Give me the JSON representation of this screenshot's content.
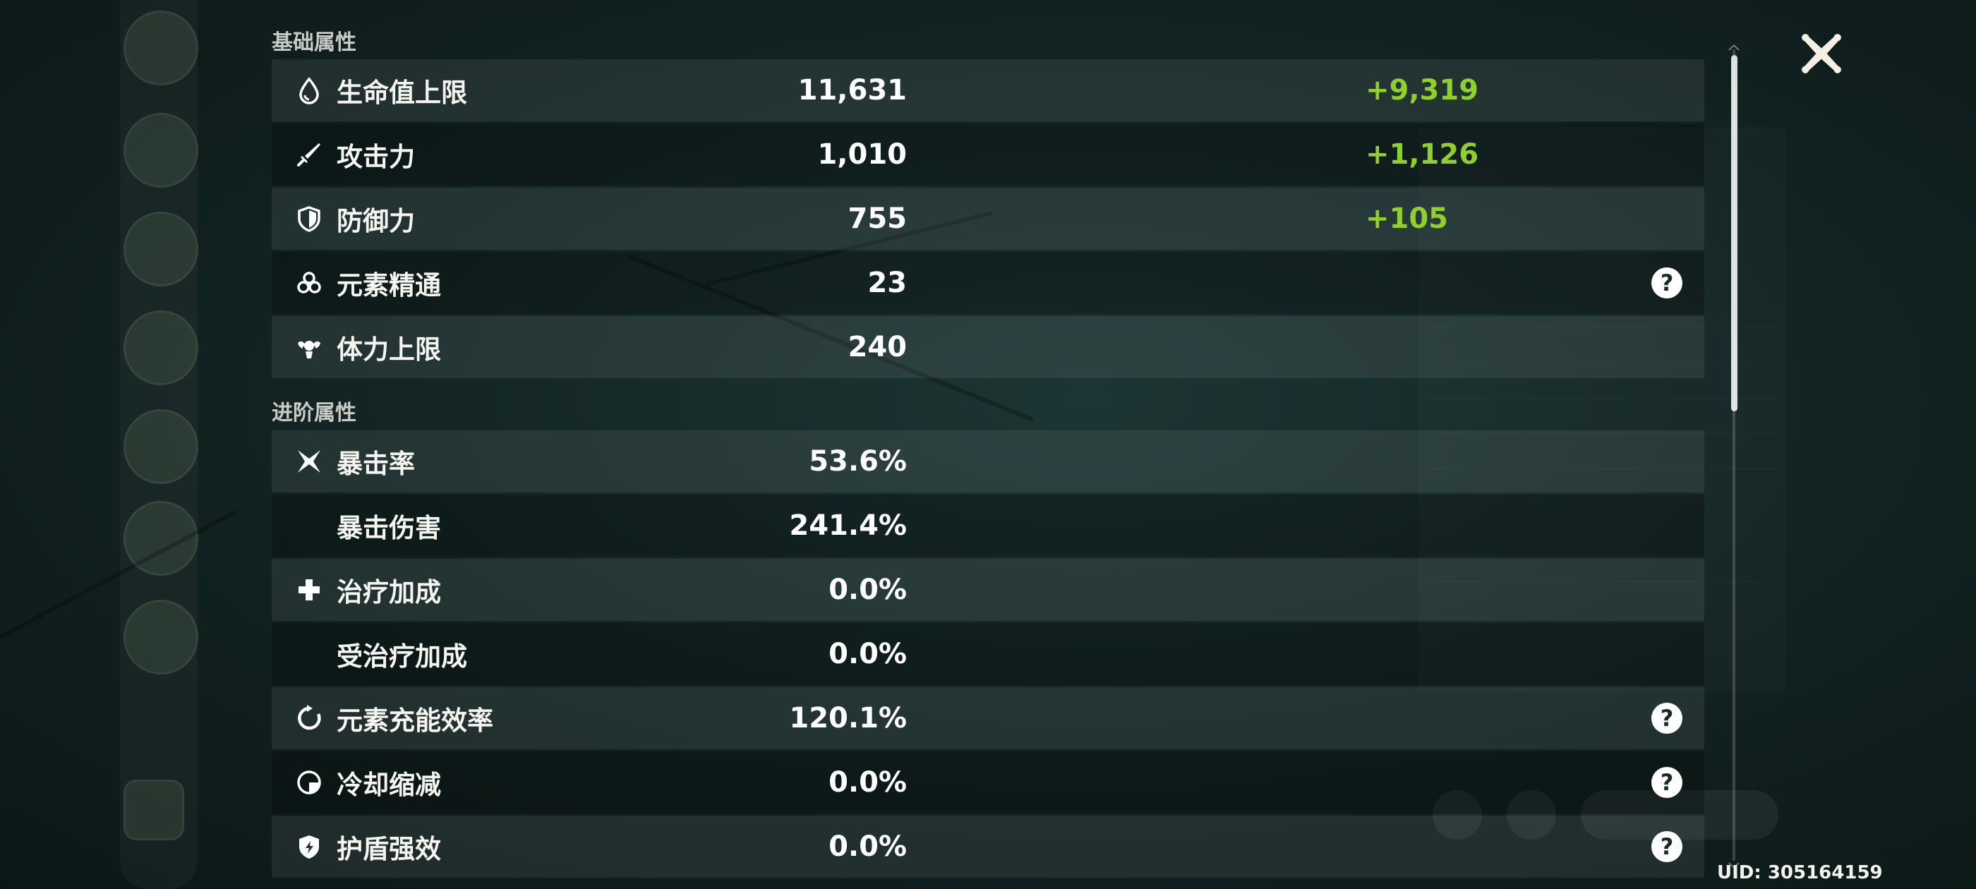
{
  "sections": {
    "basic_title": "基础属性",
    "advanced_title": "进阶属性"
  },
  "basic_stats": [
    {
      "label": "生命值上限",
      "value": "11,631",
      "bonus": "+9,319",
      "icon": "hp-drop-icon"
    },
    {
      "label": "攻击力",
      "value": "1,010",
      "bonus": "+1,126",
      "icon": "sword-icon"
    },
    {
      "label": "防御力",
      "value": "755",
      "bonus": "+105",
      "icon": "shield-icon"
    },
    {
      "label": "元素精通",
      "value": "23",
      "bonus": "",
      "icon": "elemental-mastery-icon",
      "help": "?"
    },
    {
      "label": "体力上限",
      "value": "240",
      "bonus": "",
      "icon": "stamina-icon"
    }
  ],
  "advanced_stats": [
    {
      "label": "暴击率",
      "value": "53.6%",
      "icon": "crit-star-icon"
    },
    {
      "label": "暴击伤害",
      "value": "241.4%",
      "icon": ""
    },
    {
      "label": "治疗加成",
      "value": "0.0%",
      "icon": "healing-cross-icon"
    },
    {
      "label": "受治疗加成",
      "value": "0.0%",
      "icon": ""
    },
    {
      "label": "元素充能效率",
      "value": "120.1%",
      "icon": "energy-recharge-icon",
      "help": "?"
    },
    {
      "label": "冷却缩减",
      "value": "0.0%",
      "icon": "cooldown-icon",
      "help": "?"
    },
    {
      "label": "护盾强效",
      "value": "0.0%",
      "icon": "shield-strength-icon",
      "help": "?"
    }
  ],
  "uid": "UID: 305164159",
  "colors": {
    "bonus_green": "#8fd12a",
    "help_bg": "#ffffff",
    "text": "#f4f4f0"
  }
}
